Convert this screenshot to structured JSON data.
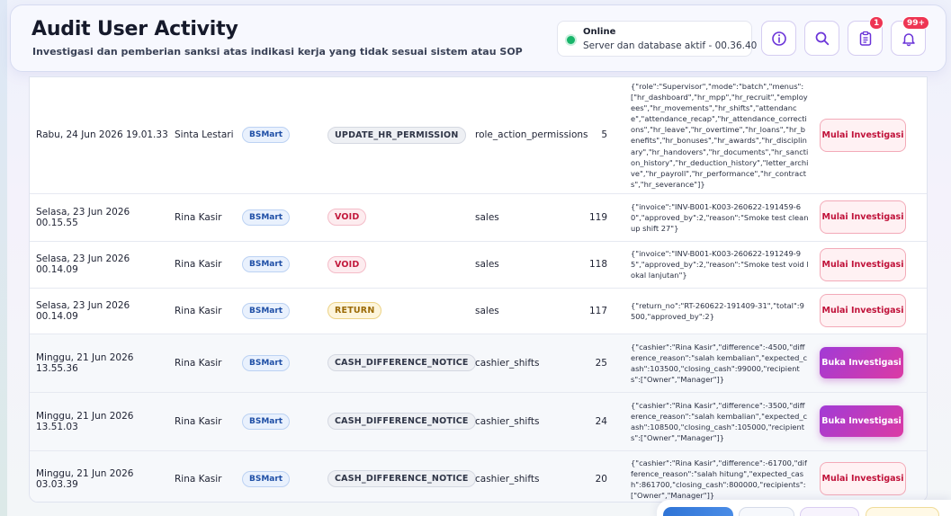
{
  "header": {
    "title": "Audit User Activity",
    "subtitle": "Investigasi dan pemberian sanksi atas indikasi kerja yang tidak sesuai sistem atau SOP",
    "status": {
      "label": "Online",
      "text": "Server dan database aktif - 00.36.40",
      "color": "#18b56a"
    },
    "buttons": [
      {
        "name": "info-icon",
        "badge": null
      },
      {
        "name": "search-icon",
        "badge": null
      },
      {
        "name": "clipboard-icon",
        "badge": "1"
      },
      {
        "name": "bell-icon",
        "badge": "99+"
      }
    ]
  },
  "table": {
    "rows": [
      {
        "time": "Rabu, 24 Jun 2026 19.01.33",
        "user": "Sinta Lestari",
        "outlet": "BSMart",
        "action": "UPDATE_HR_PERMISSION",
        "action_style": "gray",
        "table": "role_action_permissions",
        "id": "5",
        "payload": "{\"role\":\"Supervisor\",\"mode\":\"batch\",\"menus\":[\"hr_dashboard\",\"hr_mpp\",\"hr_recruit\",\"employees\",\"hr_movements\",\"hr_shifts\",\"attendance\",\"attendance_recap\",\"hr_attendance_corrections\",\"hr_leave\",\"hr_overtime\",\"hr_loans\",\"hr_benefits\",\"hr_bonuses\",\"hr_awards\",\"hr_disciplinary\",\"hr_handovers\",\"hr_documents\",\"hr_sanction_history\",\"hr_deduction_history\",\"letter_archive\",\"hr_payroll\",\"hr_performance\",\"hr_contracts\",\"hr_severance\"]}",
        "button": "Mulai Investigasi",
        "button_style": "mulai"
      },
      {
        "time": "Selasa, 23 Jun 2026 00.15.55",
        "user": "Rina Kasir",
        "outlet": "BSMart",
        "action": "VOID",
        "action_style": "red",
        "table": "sales",
        "id": "119",
        "payload": "{\"invoice\":\"INV-B001-K003-260622-191459-60\",\"approved_by\":2,\"reason\":\"Smoke test cleanup shift 27\"}",
        "button": "Mulai Investigasi",
        "button_style": "mulai"
      },
      {
        "time": "Selasa, 23 Jun 2026 00.14.09",
        "user": "Rina Kasir",
        "outlet": "BSMart",
        "action": "VOID",
        "action_style": "red",
        "table": "sales",
        "id": "118",
        "payload": "{\"invoice\":\"INV-B001-K003-260622-191249-95\",\"approved_by\":2,\"reason\":\"Smoke test void lokal lanjutan\"}",
        "button": "Mulai Investigasi",
        "button_style": "mulai"
      },
      {
        "time": "Selasa, 23 Jun 2026 00.14.09",
        "user": "Rina Kasir",
        "outlet": "BSMart",
        "action": "RETURN",
        "action_style": "yellow",
        "table": "sales",
        "id": "117",
        "payload": "{\"return_no\":\"RT-260622-191409-31\",\"total\":9500,\"approved_by\":2}",
        "button": "Mulai Investigasi",
        "button_style": "mulai"
      },
      {
        "time": "Minggu, 21 Jun 2026 13.55.36",
        "user": "Rina Kasir",
        "outlet": "BSMart",
        "action": "CASH_DIFFERENCE_NOTICE",
        "action_style": "gray",
        "table": "cashier_shifts",
        "id": "25",
        "payload": "{\"cashier\":\"Rina Kasir\",\"difference\":-4500,\"difference_reason\":\"salah kembalian\",\"expected_cash\":103500,\"closing_cash\":99000,\"recipients\":[\"Owner\",\"Manager\"]}",
        "button": "Buka Investigasi",
        "button_style": "buka"
      },
      {
        "time": "Minggu, 21 Jun 2026 13.51.03",
        "user": "Rina Kasir",
        "outlet": "BSMart",
        "action": "CASH_DIFFERENCE_NOTICE",
        "action_style": "gray",
        "table": "cashier_shifts",
        "id": "24",
        "payload": "{\"cashier\":\"Rina Kasir\",\"difference\":-3500,\"difference_reason\":\"salah kembalian\",\"expected_cash\":108500,\"closing_cash\":105000,\"recipients\":[\"Owner\",\"Manager\"]}",
        "button": "Buka Investigasi",
        "button_style": "buka"
      },
      {
        "time": "Minggu, 21 Jun 2026 03.03.39",
        "user": "Rina Kasir",
        "outlet": "BSMart",
        "action": "CASH_DIFFERENCE_NOTICE",
        "action_style": "gray",
        "table": "cashier_shifts",
        "id": "20",
        "payload": "{\"cashier\":\"Rina Kasir\",\"difference\":-61700,\"difference_reason\":\"salah hitung\",\"expected_cash\":861700,\"closing_cash\":800000,\"recipients\":[\"Owner\",\"Manager\"]}",
        "button": "Mulai Investigasi",
        "button_style": "mulai"
      }
    ]
  }
}
